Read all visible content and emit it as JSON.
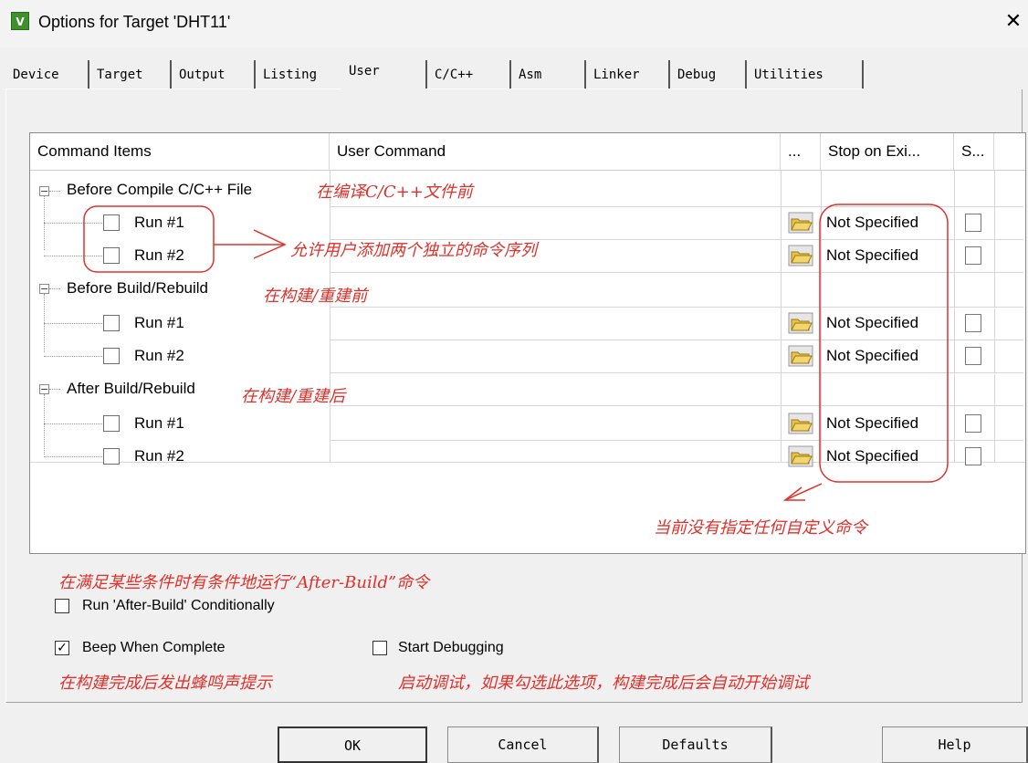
{
  "window": {
    "title": "Options for Target 'DHT11'",
    "app_icon_text": "V",
    "close_glyph": "✕"
  },
  "tabs": [
    {
      "label": "Device"
    },
    {
      "label": "Target"
    },
    {
      "label": "Output"
    },
    {
      "label": "Listing"
    },
    {
      "label": "User",
      "active": true
    },
    {
      "label": "C/C++"
    },
    {
      "label": "Asm"
    },
    {
      "label": "Linker"
    },
    {
      "label": "Debug"
    },
    {
      "label": "Utilities"
    }
  ],
  "grid": {
    "columns": [
      "Command Items",
      "User Command",
      "...",
      "Stop on Exi...",
      "S..."
    ],
    "groups": [
      {
        "label": "Before Compile C/C++ File",
        "note": "在编译C/C++文件前",
        "runs": [
          {
            "label": "Run #1",
            "stop": "Not Specified"
          },
          {
            "label": "Run #2",
            "stop": "Not Specified"
          }
        ]
      },
      {
        "label": "Before Build/Rebuild",
        "note": "在构建/重建前",
        "runs": [
          {
            "label": "Run #1",
            "stop": "Not Specified"
          },
          {
            "label": "Run #2",
            "stop": "Not Specified"
          }
        ]
      },
      {
        "label": "After Build/Rebuild",
        "note": "在构建/重建后",
        "runs": [
          {
            "label": "Run #1",
            "stop": "Not Specified"
          },
          {
            "label": "Run #2",
            "stop": "Not Specified"
          }
        ]
      }
    ]
  },
  "annotations": {
    "two_sequences": "允许用户添加两个独立的命令序列",
    "no_custom": "当前没有指定任何自定义命令",
    "conditional": "在满足某些条件时有条件地运行“After-Build”命令",
    "beep": "在构建完成后发出蜂鸣声提示",
    "debug": "启动调试，如果勾选此选项，构建完成后会自动开始调试"
  },
  "options": {
    "run_after_build": {
      "label": "Run 'After-Build' Conditionally",
      "checked": false
    },
    "beep_when_complete": {
      "label": "Beep When Complete",
      "checked": true
    },
    "start_debugging": {
      "label": "Start Debugging",
      "checked": false
    }
  },
  "buttons": {
    "ok": "OK",
    "cancel": "Cancel",
    "defaults": "Defaults",
    "help": "Help"
  },
  "colors": {
    "annotation": "#e0302a",
    "folder": "#e8c24a"
  }
}
